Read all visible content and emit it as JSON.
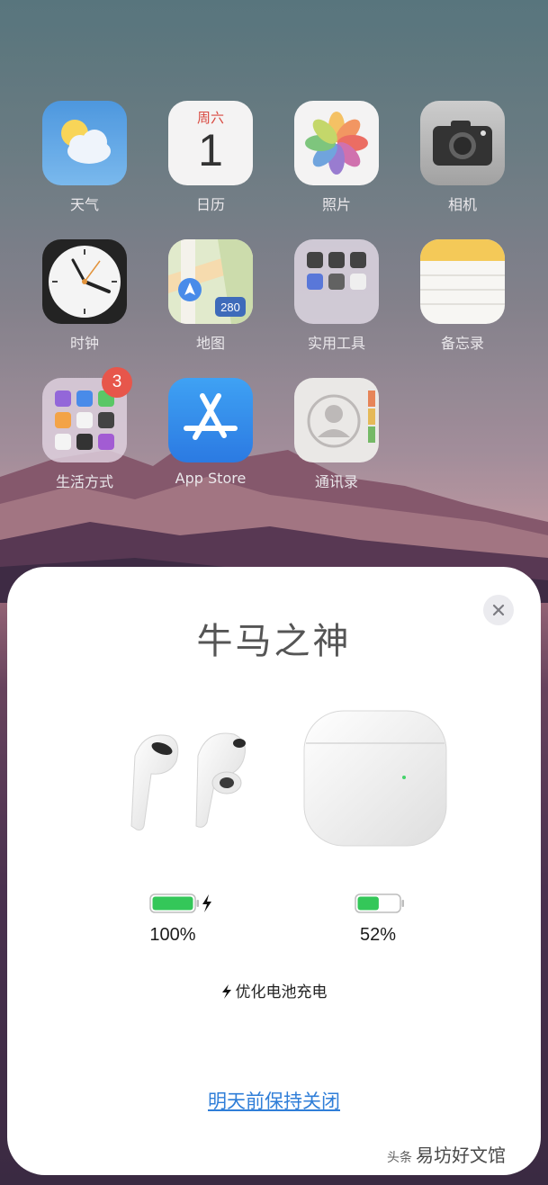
{
  "home_apps": [
    {
      "id": "weather",
      "label": "天气"
    },
    {
      "id": "calendar",
      "label": "日历",
      "weekday": "周六",
      "day": "1"
    },
    {
      "id": "photos",
      "label": "照片"
    },
    {
      "id": "camera",
      "label": "相机"
    },
    {
      "id": "clock",
      "label": "时钟"
    },
    {
      "id": "maps",
      "label": "地图",
      "route": "280"
    },
    {
      "id": "utilities",
      "label": "实用工具"
    },
    {
      "id": "notes",
      "label": "备忘录"
    },
    {
      "id": "lifestyle",
      "label": "生活方式",
      "badge": "3"
    },
    {
      "id": "appstore",
      "label": "App Store"
    },
    {
      "id": "contacts",
      "label": "通讯录"
    }
  ],
  "popup": {
    "device_name": "牛马之神",
    "close_icon": "close-icon",
    "earbuds": {
      "battery_pct": "100%",
      "battery_level": 1.0,
      "charging": true
    },
    "case": {
      "battery_pct": "52%",
      "battery_level": 0.52,
      "charging": false
    },
    "optimized_charging": "优化电池充电",
    "keep_off_link": "明天前保持关闭"
  },
  "watermark": {
    "prefix": "头条",
    "text": "易坊好文馆"
  },
  "colors": {
    "battery_green": "#34c759",
    "link_blue": "#2f7ed8",
    "badge_red": "#e5483c"
  }
}
